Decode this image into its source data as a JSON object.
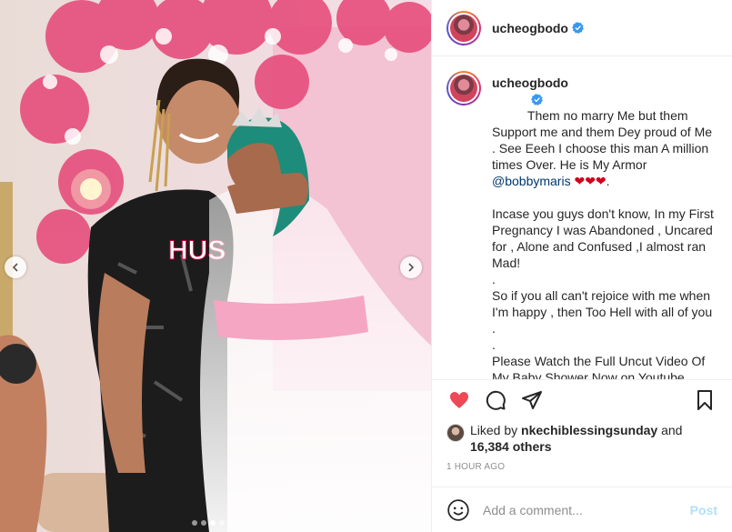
{
  "header": {
    "username": "ucheogbodo",
    "verified": true
  },
  "caption": {
    "username": "ucheogbodo",
    "part1": "Them no marry Me but them Support me and them Dey proud of Me . See Eeeh I choose this man A million times Over. He is My Armor ",
    "mention": "@bobbymaris",
    "emoji_hearts": "❤❤❤",
    "part1_end": ".",
    "part2": "\nIncase you guys don't know, In my First Pregnancy I was Abandoned , Uncared for , Alone and Confused ,I almost ran Mad!\n.\nSo if you all can't rejoice with me when I'm happy , then Too Hell with all of you .\n.\nPlease Watch the Full Uncut Video Of My Baby Shower Now on Youtube through the link in my Bio . You will like it ",
    "emoji_end": "😻😻😻"
  },
  "actions": {
    "like_icon": "heart-icon",
    "comment_icon": "comment-icon",
    "share_icon": "paper-plane-icon",
    "save_icon": "bookmark-icon",
    "like_color": "#ed4956"
  },
  "likes": {
    "prefix": "Liked by ",
    "user": "nkechiblessingsunday",
    "and": " and",
    "others": "16,384 others"
  },
  "timestamp": "1 HOUR AGO",
  "comment_box": {
    "placeholder": "Add a comment...",
    "post_label": "Post"
  },
  "carousel": {
    "total": 5,
    "active_index": 2
  }
}
